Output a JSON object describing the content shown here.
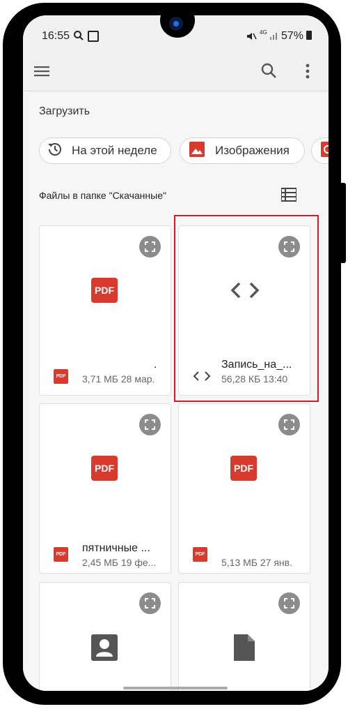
{
  "status_bar": {
    "time": "16:55",
    "battery": "57%",
    "network": "4G"
  },
  "header": {
    "menu_icon": "hamburger-icon",
    "search_icon": "search-icon",
    "more_icon": "more-vert-icon"
  },
  "upload": {
    "title": "Загрузить"
  },
  "chips": [
    {
      "label": "На этой неделе",
      "icon": "history-icon"
    },
    {
      "label": "Изображения",
      "icon": "image-icon"
    }
  ],
  "files_section": {
    "title": "Файлы в папке \"Скачанные\"",
    "view_icon": "list-view-icon"
  },
  "files": [
    {
      "type": "PDF",
      "name": ".",
      "meta": "3,71 МБ 28 мар."
    },
    {
      "type": "code",
      "name": "Запись_на_...",
      "meta": "56,28 КБ 13:40"
    },
    {
      "type": "PDF",
      "name": "пятничные ...",
      "meta": "2,45 МБ 19 фе..."
    },
    {
      "type": "PDF",
      "name": "",
      "meta": "5,13 МБ 27 янв."
    },
    {
      "type": "contact",
      "name": "",
      "meta": ""
    },
    {
      "type": "document",
      "name": "",
      "meta": ""
    }
  ],
  "badges": {
    "pdf": "PDF"
  },
  "colors": {
    "pdf_red": "#d93a2e",
    "highlight": "#e0171e"
  }
}
